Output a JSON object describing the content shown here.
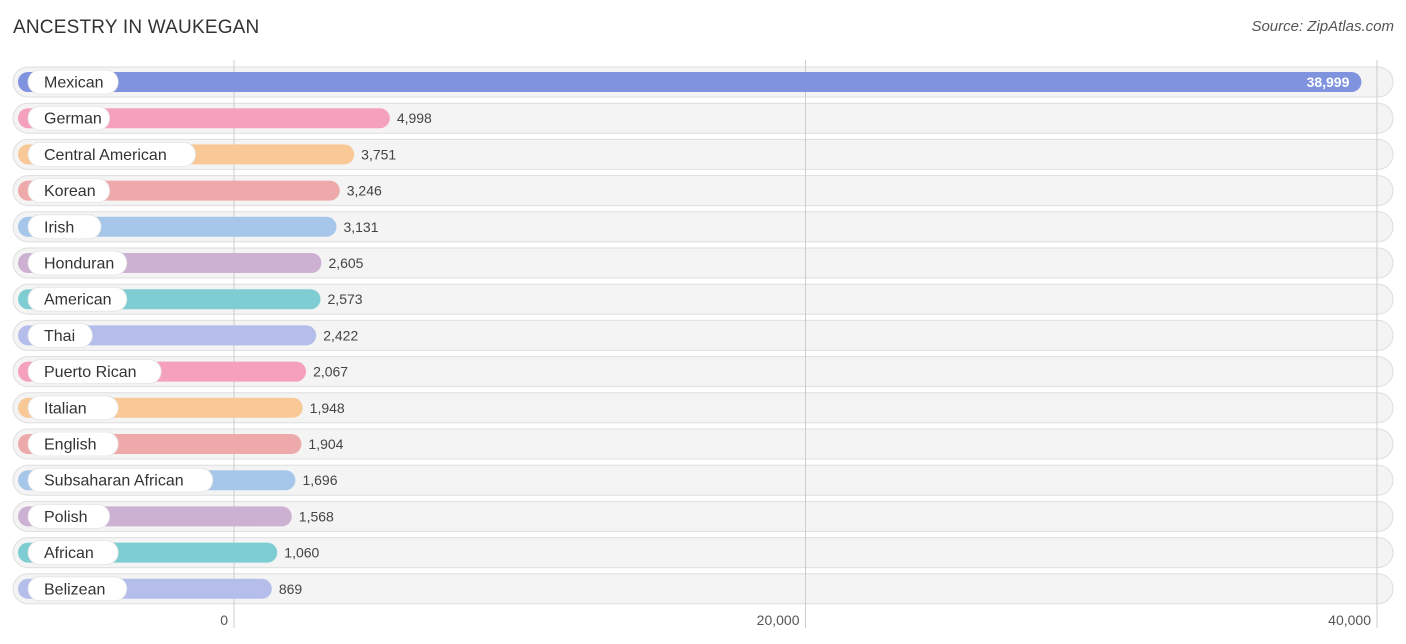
{
  "header": {
    "title": "ANCESTRY IN WAUKEGAN",
    "source": "Source: ZipAtlas.com"
  },
  "chart_data": {
    "type": "bar",
    "orientation": "horizontal",
    "title": "ANCESTRY IN WAUKEGAN",
    "xlabel": "",
    "ylabel": "",
    "xlim": [
      0,
      40000
    ],
    "grid": true,
    "ticks": [
      {
        "value": 0,
        "label": "0"
      },
      {
        "value": 20000,
        "label": "20,000"
      },
      {
        "value": 40000,
        "label": "40,000"
      }
    ],
    "categories": [
      "Mexican",
      "German",
      "Central American",
      "Korean",
      "Irish",
      "Honduran",
      "American",
      "Thai",
      "Puerto Rican",
      "Italian",
      "English",
      "Subsaharan African",
      "Polish",
      "African",
      "Belizean"
    ],
    "values": [
      38999,
      4998,
      3751,
      3246,
      3131,
      2605,
      2573,
      2422,
      2067,
      1948,
      1904,
      1696,
      1568,
      1060,
      869
    ],
    "value_labels": [
      "38,999",
      "4,998",
      "3,751",
      "3,246",
      "3,131",
      "2,605",
      "2,573",
      "2,422",
      "2,067",
      "1,948",
      "1,904",
      "1,696",
      "1,568",
      "1,060",
      "869"
    ],
    "colors": [
      "#7f93de",
      "#f5a0bd",
      "#f9c897",
      "#eeaaab",
      "#a6c6ea",
      "#cdb1d3",
      "#7ecdd2",
      "#b5bdeb",
      "#f5a0bd",
      "#f9c897",
      "#eeaaab",
      "#a6c6ea",
      "#cdb1d3",
      "#7ecdd2",
      "#b5bdeb"
    ]
  }
}
